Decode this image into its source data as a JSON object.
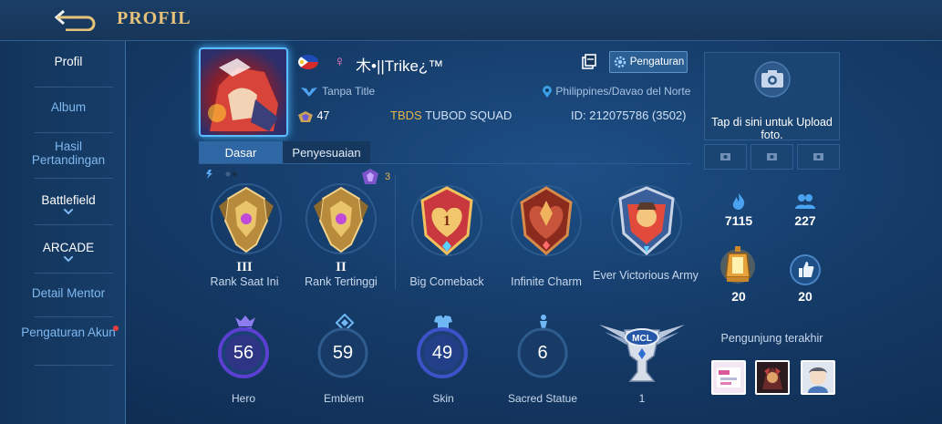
{
  "header": {
    "title": "PROFIL",
    "back_icon": "back-arrow-icon"
  },
  "sidebar": {
    "items": [
      {
        "label": "Profil",
        "active": true
      },
      {
        "label": "Album"
      },
      {
        "label": "Hasil Pertandingan"
      },
      {
        "label": "Battlefield",
        "has_chevron": true
      },
      {
        "label": "ARCADE",
        "has_chevron": true
      },
      {
        "label": "Detail Mentor"
      },
      {
        "label": "Pengaturan Akun",
        "has_dot": true
      }
    ]
  },
  "profile": {
    "username": "木•||Trike¿™",
    "gender_symbol": "♀",
    "title": "Tanpa Title",
    "level": "47",
    "squad_tag": "TBDS",
    "squad_name": "TUBOD SQUAD",
    "location": "Philippines/Davao del Norte",
    "id_label": "ID: 212075786 (3502)",
    "settings_label": "Pengaturan"
  },
  "tabs": [
    {
      "label": "Dasar",
      "active": true
    },
    {
      "label": "Penyesuaian"
    }
  ],
  "rank_badge_count": "3",
  "badges": [
    {
      "label": "Rank Saat Ini",
      "roman": "III"
    },
    {
      "label": "Rank Tertinggi",
      "roman": "II"
    },
    {
      "label": "Big Comeback"
    },
    {
      "label": "Infinite Charm"
    },
    {
      "label": "Ever Victorious Army"
    }
  ],
  "stats": [
    {
      "label": "Hero",
      "value": "56"
    },
    {
      "label": "Emblem",
      "value": "59"
    },
    {
      "label": "Skin",
      "value": "49"
    },
    {
      "label": "Sacred Statue",
      "value": "6"
    },
    {
      "label": "1",
      "value": "MCL"
    }
  ],
  "right_panel": {
    "upload_text": "Tap di sini untuk Upload foto.",
    "stats": [
      {
        "icon": "flame-icon",
        "value": "7115"
      },
      {
        "icon": "people-icon",
        "value": "227"
      },
      {
        "icon": "lantern-icon",
        "value": "20"
      },
      {
        "icon": "thumbs-up-icon",
        "value": "20"
      }
    ],
    "visitors_label": "Pengunjung terakhir"
  },
  "colors": {
    "accent_gold": "#e6c27a",
    "tab_active": "#2e67a3",
    "link_blue": "#7fb8f0"
  }
}
